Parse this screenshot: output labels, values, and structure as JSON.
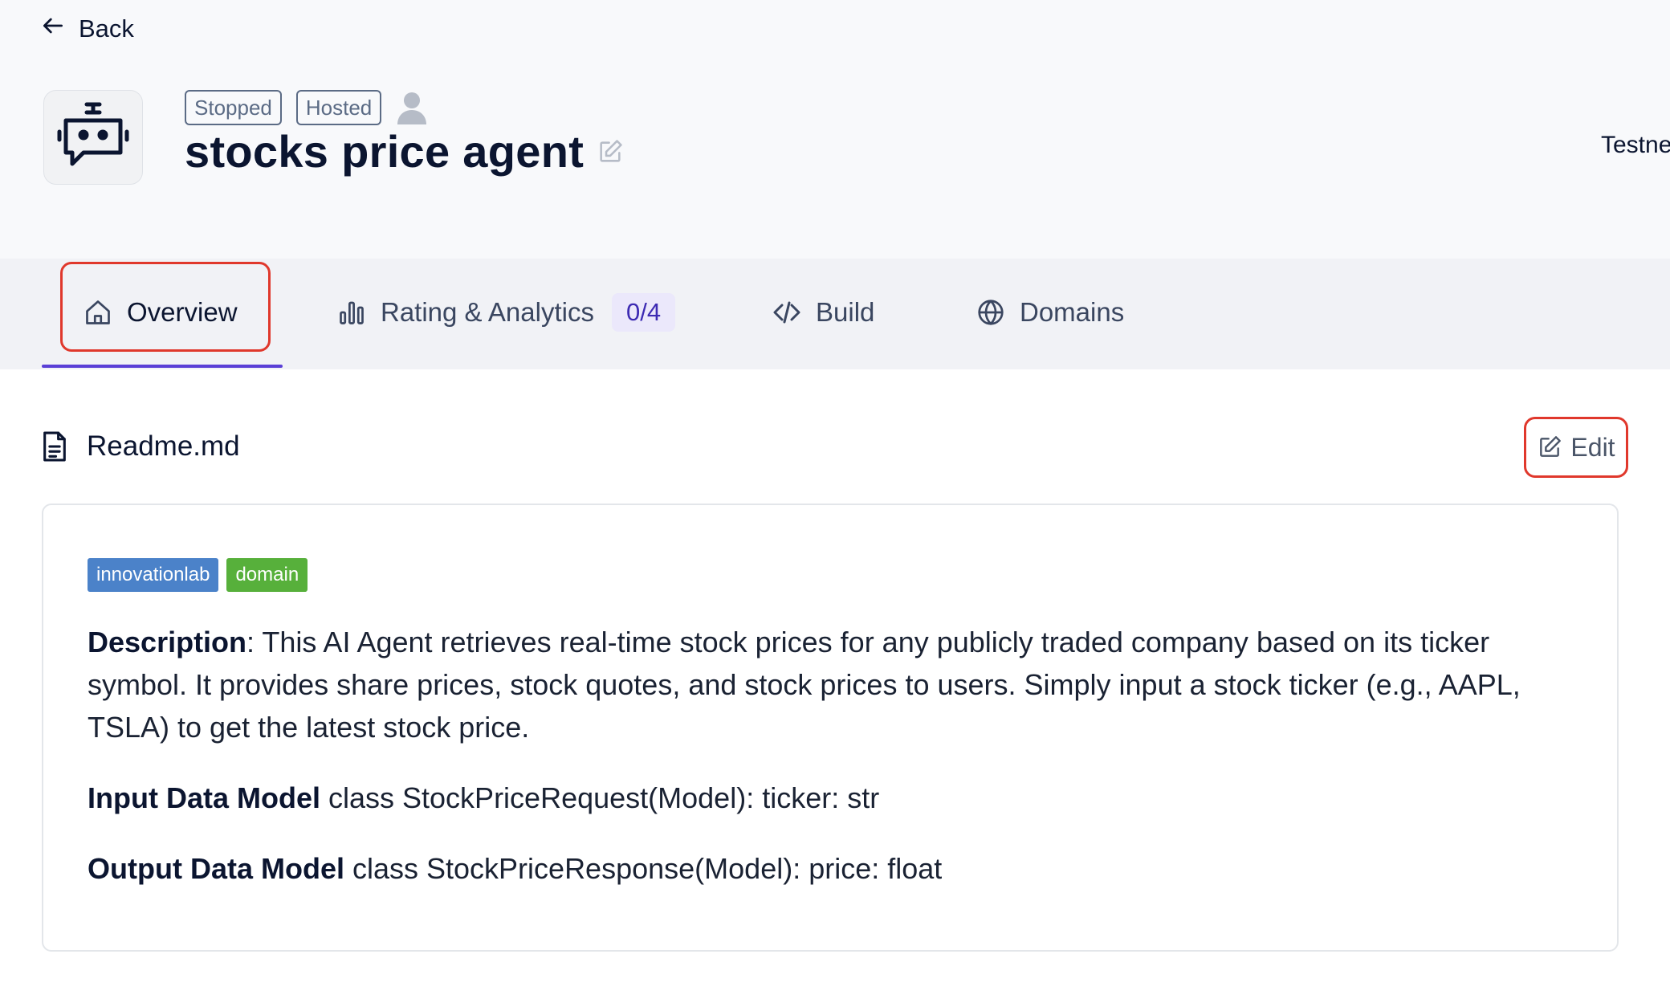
{
  "nav": {
    "back_label": "Back"
  },
  "agent": {
    "badges": [
      "Stopped",
      "Hosted"
    ],
    "title": "stocks price agent",
    "network": "Testnet"
  },
  "tabs": [
    {
      "label": "Overview",
      "icon": "home-icon"
    },
    {
      "label": "Rating & Analytics",
      "icon": "bar-chart-icon",
      "count": "0/4"
    },
    {
      "label": "Build",
      "icon": "code-icon"
    },
    {
      "label": "Domains",
      "icon": "globe-icon"
    }
  ],
  "readme": {
    "filename": "Readme.md",
    "edit_label": "Edit",
    "tags": [
      "innovationlab",
      "domain"
    ],
    "description_label": "Description",
    "description_text": ": This AI Agent retrieves real-time stock prices for any publicly traded company based on its ticker symbol. It provides share prices, stock quotes, and stock prices to users. Simply input a stock ticker (e.g., AAPL, TSLA) to get the latest stock price.",
    "input_label": "Input Data Model",
    "input_text": " class StockPriceRequest(Model): ticker: str",
    "output_label": "Output Data Model",
    "output_text": " class StockPriceResponse(Model): price: float"
  },
  "colors": {
    "accent": "#5a3fd6",
    "highlight": "#e0382c",
    "tag_blue": "#4b82c9",
    "tag_green": "#57b03b"
  }
}
